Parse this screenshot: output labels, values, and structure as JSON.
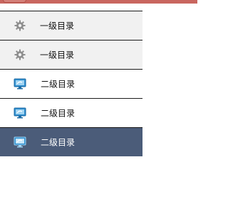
{
  "colors": {
    "top_bar": "#c9665f",
    "level1_bg": "#f1f1f1",
    "level2_bg": "#ffffff",
    "active_bg": "#4b5c79",
    "active_text": "#ffffff"
  },
  "menu": {
    "items": [
      {
        "label": "一级目录",
        "level": 1,
        "icon": "gear-icon",
        "active": false
      },
      {
        "label": "一级目录",
        "level": 1,
        "icon": "gear-icon",
        "active": false
      },
      {
        "label": "二级目录",
        "level": 2,
        "icon": "monitor-icon",
        "active": false
      },
      {
        "label": "二级目录",
        "level": 2,
        "icon": "monitor-icon",
        "active": false
      },
      {
        "label": "二级目录",
        "level": 2,
        "icon": "monitor-icon",
        "active": true
      }
    ]
  }
}
